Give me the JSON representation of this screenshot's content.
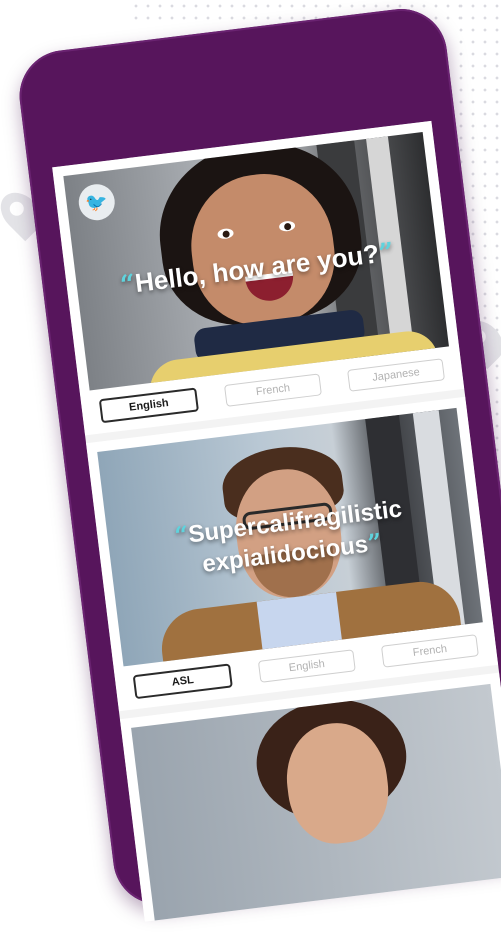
{
  "app": {
    "brand_icon": "bird-icon",
    "colors": {
      "phone": "#57155c",
      "quote_mark": "#5fd3dd",
      "active_tab_border": "#2a2a2a"
    }
  },
  "cards": [
    {
      "quote_open": "“",
      "quote_text": "Hello, how are you?",
      "quote_close": "”",
      "tabs": [
        {
          "label": "English",
          "active": true
        },
        {
          "label": "French",
          "active": false
        },
        {
          "label": "Japanese",
          "active": false
        }
      ]
    },
    {
      "quote_open": "“",
      "quote_line1": "Supercalifragilistic",
      "quote_line2": "expialidocious",
      "quote_close": "”",
      "tabs": [
        {
          "label": "ASL",
          "active": true
        },
        {
          "label": "English",
          "active": false
        },
        {
          "label": "French",
          "active": false
        }
      ]
    }
  ]
}
